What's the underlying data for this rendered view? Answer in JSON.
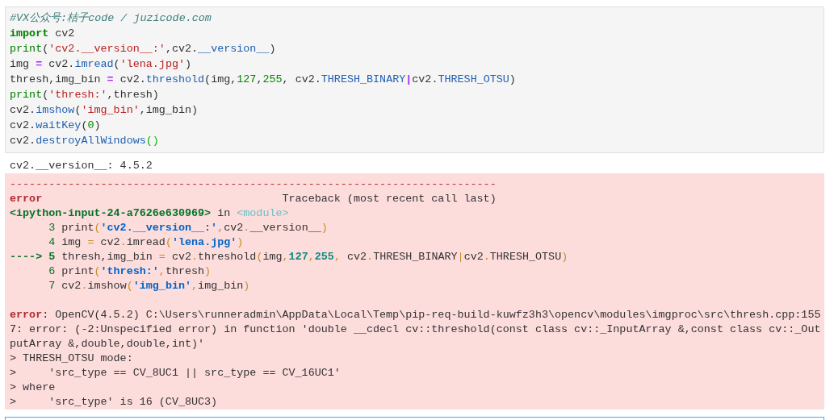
{
  "input_cell": {
    "lines": [
      [
        {
          "kind": "comment",
          "text": "#VX公众号:桔子code / juzicode.com"
        }
      ],
      [
        {
          "kind": "keyword",
          "text": "import"
        },
        {
          "kind": "plain",
          "text": " cv2"
        }
      ],
      [
        {
          "kind": "builtin",
          "text": "print"
        },
        {
          "kind": "plain",
          "text": "("
        },
        {
          "kind": "string",
          "text": "'cv2.__version__:'"
        },
        {
          "kind": "plain",
          "text": ",cv2."
        },
        {
          "kind": "attr",
          "text": "__version__"
        },
        {
          "kind": "plain",
          "text": ")"
        }
      ],
      [
        {
          "kind": "plain",
          "text": "img "
        },
        {
          "kind": "operator",
          "text": "="
        },
        {
          "kind": "plain",
          "text": " cv2."
        },
        {
          "kind": "attr",
          "text": "imread"
        },
        {
          "kind": "plain",
          "text": "("
        },
        {
          "kind": "string",
          "text": "'lena.jpg'"
        },
        {
          "kind": "plain",
          "text": ")"
        }
      ],
      [
        {
          "kind": "plain",
          "text": "thresh,img_bin "
        },
        {
          "kind": "operator",
          "text": "="
        },
        {
          "kind": "plain",
          "text": " cv2."
        },
        {
          "kind": "attr",
          "text": "threshold"
        },
        {
          "kind": "plain",
          "text": "(img,"
        },
        {
          "kind": "number",
          "text": "127"
        },
        {
          "kind": "plain",
          "text": ","
        },
        {
          "kind": "number",
          "text": "255"
        },
        {
          "kind": "plain",
          "text": ", cv2."
        },
        {
          "kind": "attr",
          "text": "THRESH_BINARY"
        },
        {
          "kind": "operator",
          "text": "|"
        },
        {
          "kind": "plain",
          "text": "cv2."
        },
        {
          "kind": "attr",
          "text": "THRESH_OTSU"
        },
        {
          "kind": "plain",
          "text": ")"
        }
      ],
      [
        {
          "kind": "builtin",
          "text": "print"
        },
        {
          "kind": "plain",
          "text": "("
        },
        {
          "kind": "string",
          "text": "'thresh:'"
        },
        {
          "kind": "plain",
          "text": ",thresh)"
        }
      ],
      [
        {
          "kind": "plain",
          "text": "cv2."
        },
        {
          "kind": "attr",
          "text": "imshow"
        },
        {
          "kind": "plain",
          "text": "("
        },
        {
          "kind": "string",
          "text": "'img_bin'"
        },
        {
          "kind": "plain",
          "text": ",img_bin)"
        }
      ],
      [
        {
          "kind": "plain",
          "text": "cv2."
        },
        {
          "kind": "attr",
          "text": "waitKey"
        },
        {
          "kind": "plain",
          "text": "("
        },
        {
          "kind": "number",
          "text": "0"
        },
        {
          "kind": "plain",
          "text": ")"
        }
      ],
      [
        {
          "kind": "plain",
          "text": "cv2."
        },
        {
          "kind": "attr",
          "text": "destroyAllWindows"
        },
        {
          "kind": "matched",
          "text": "()"
        }
      ]
    ]
  },
  "stdout": [
    "cv2.__version__: 4.5.2"
  ],
  "error": {
    "traceback": [
      [
        {
          "kind": "red",
          "text": "---------------------------------------------------------------------------"
        }
      ],
      [
        {
          "kind": "red-bold",
          "text": "error"
        },
        {
          "kind": "plain",
          "text": "                                     Traceback (most recent call last)"
        }
      ],
      [
        {
          "kind": "green-bold",
          "text": "<ipython-input-24-a7626e630969>"
        },
        {
          "kind": "plain",
          "text": " in "
        },
        {
          "kind": "cyan",
          "text": "<module>"
        }
      ],
      [
        {
          "kind": "green",
          "text": "      3"
        },
        {
          "kind": "plain",
          "text": " print"
        },
        {
          "kind": "yellow",
          "text": "("
        },
        {
          "kind": "blue-bold",
          "text": "'cv2.__version__:'"
        },
        {
          "kind": "yellow",
          "text": ","
        },
        {
          "kind": "plain",
          "text": "cv2"
        },
        {
          "kind": "yellow",
          "text": "."
        },
        {
          "kind": "plain",
          "text": "__version__"
        },
        {
          "kind": "yellow",
          "text": ")"
        }
      ],
      [
        {
          "kind": "green",
          "text": "      4"
        },
        {
          "kind": "plain",
          "text": " img "
        },
        {
          "kind": "yellow",
          "text": "="
        },
        {
          "kind": "plain",
          "text": " cv2"
        },
        {
          "kind": "yellow",
          "text": "."
        },
        {
          "kind": "plain",
          "text": "imread"
        },
        {
          "kind": "yellow",
          "text": "("
        },
        {
          "kind": "blue-bold",
          "text": "'lena.jpg'"
        },
        {
          "kind": "yellow",
          "text": ")"
        }
      ],
      [
        {
          "kind": "green-bold",
          "text": "----> 5"
        },
        {
          "kind": "plain",
          "text": " thresh,img_bin "
        },
        {
          "kind": "yellow",
          "text": "="
        },
        {
          "kind": "plain",
          "text": " cv2"
        },
        {
          "kind": "yellow",
          "text": "."
        },
        {
          "kind": "plain",
          "text": "threshold"
        },
        {
          "kind": "yellow",
          "text": "("
        },
        {
          "kind": "plain",
          "text": "img"
        },
        {
          "kind": "yellow",
          "text": ","
        },
        {
          "kind": "teal",
          "text": "127"
        },
        {
          "kind": "yellow",
          "text": ","
        },
        {
          "kind": "teal",
          "text": "255"
        },
        {
          "kind": "yellow",
          "text": ","
        },
        {
          "kind": "plain",
          "text": " cv2"
        },
        {
          "kind": "yellow",
          "text": "."
        },
        {
          "kind": "plain",
          "text": "THRESH_BINARY"
        },
        {
          "kind": "yellow",
          "text": "|"
        },
        {
          "kind": "plain",
          "text": "cv2"
        },
        {
          "kind": "yellow",
          "text": "."
        },
        {
          "kind": "plain",
          "text": "THRESH_OTSU"
        },
        {
          "kind": "yellow",
          "text": ")"
        }
      ],
      [
        {
          "kind": "green",
          "text": "      6"
        },
        {
          "kind": "plain",
          "text": " print"
        },
        {
          "kind": "yellow",
          "text": "("
        },
        {
          "kind": "blue-bold",
          "text": "'thresh:'"
        },
        {
          "kind": "yellow",
          "text": ","
        },
        {
          "kind": "plain",
          "text": "thresh"
        },
        {
          "kind": "yellow",
          "text": ")"
        }
      ],
      [
        {
          "kind": "green",
          "text": "      7"
        },
        {
          "kind": "plain",
          "text": " cv2"
        },
        {
          "kind": "yellow",
          "text": "."
        },
        {
          "kind": "plain",
          "text": "imshow"
        },
        {
          "kind": "yellow",
          "text": "("
        },
        {
          "kind": "blue-bold",
          "text": "'img_bin'"
        },
        {
          "kind": "yellow",
          "text": ","
        },
        {
          "kind": "plain",
          "text": "img_bin"
        },
        {
          "kind": "yellow",
          "text": ")"
        }
      ]
    ],
    "message": [
      [
        {
          "kind": "red-bold",
          "text": "error"
        },
        {
          "kind": "plain",
          "text": ": OpenCV(4.5.2) C:\\Users\\runneradmin\\AppData\\Local\\Temp\\pip-req-build-kuwfz3h3\\opencv\\modules\\imgproc\\src\\thresh.cpp:155"
        }
      ],
      [
        {
          "kind": "plain",
          "text": "7: error: (-2:Unspecified error) in function 'double __cdecl cv::threshold(const class cv::_InputArray &,const class cv::_Out"
        }
      ],
      [
        {
          "kind": "plain",
          "text": "putArray &,double,double,int)'"
        }
      ],
      [
        {
          "kind": "plain",
          "text": "> THRESH_OTSU mode:"
        }
      ],
      [
        {
          "kind": "plain",
          "text": ">     'src_type == CV_8UC1 || src_type == CV_16UC1'"
        }
      ],
      [
        {
          "kind": "plain",
          "text": "> where"
        }
      ],
      [
        {
          "kind": "plain",
          "text": ">     'src_type' is 16 (CV_8UC3)"
        }
      ]
    ]
  },
  "next_cell": {
    "selected": true
  }
}
